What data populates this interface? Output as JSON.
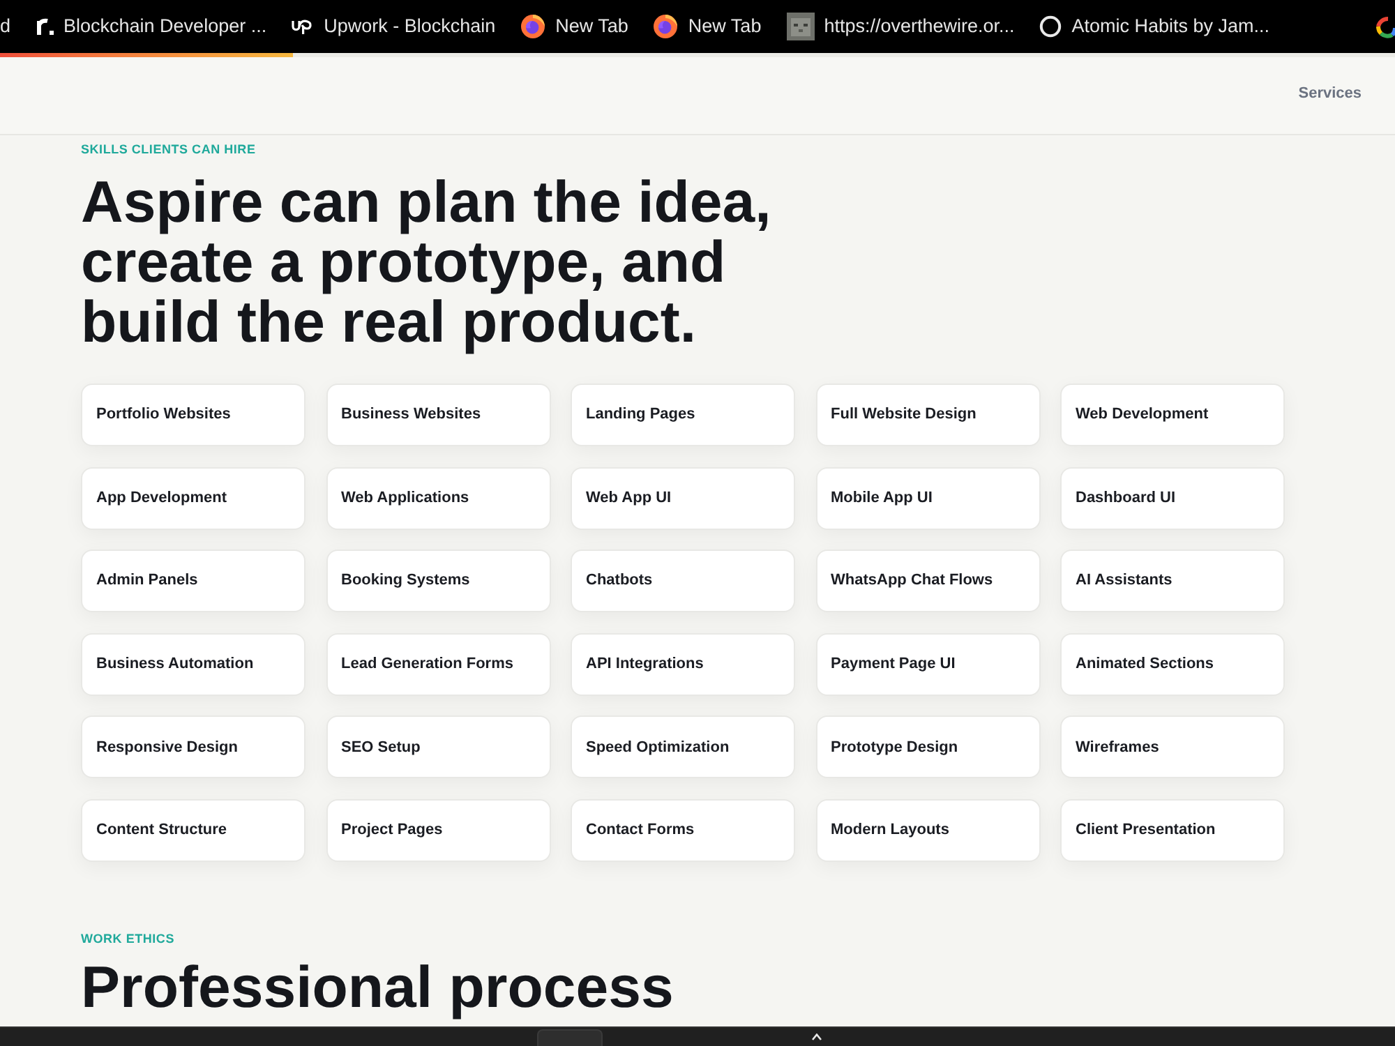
{
  "bookmarks_bar": {
    "items": [
      {
        "kind": "plain",
        "label": "d"
      },
      {
        "kind": "letter",
        "label": "Blockchain Developer ..."
      },
      {
        "kind": "upwork",
        "label": "Upwork - Blockchain"
      },
      {
        "kind": "firefox",
        "label": "New Tab"
      },
      {
        "kind": "firefox",
        "label": "New Tab"
      },
      {
        "kind": "thumbnail",
        "label": "https://overthewire.or..."
      },
      {
        "kind": "ring",
        "label": "Atomic Habits by Jam..."
      }
    ],
    "end_icon": {
      "kind": "google"
    }
  },
  "page_progress": {
    "level": 0.21
  },
  "header": {
    "nav": [
      "Services"
    ]
  },
  "skills": {
    "eyebrow": "SKILLS CLIENTS CAN HIRE",
    "heading": "Aspire can plan the idea, create a prototype, and build the real product.",
    "items": [
      "Portfolio Websites",
      "Business Websites",
      "Landing Pages",
      "Full Website Design",
      "Web Development",
      "App Development",
      "Web Applications",
      "Web App UI",
      "Mobile App UI",
      "Dashboard UI",
      "Admin Panels",
      "Booking Systems",
      "Chatbots",
      "WhatsApp Chat Flows",
      "AI Assistants",
      "Business Automation",
      "Lead Generation Forms",
      "API Integrations",
      "Payment Page UI",
      "Animated Sections",
      "Responsive Design",
      "SEO Setup",
      "Speed Optimization",
      "Prototype Design",
      "Wireframes",
      "Content Structure",
      "Project Pages",
      "Contact Forms",
      "Modern Layouts",
      "Client Presentation"
    ]
  },
  "work_ethics": {
    "eyebrow": "WORK ETHICS",
    "heading": "Professional process"
  }
}
